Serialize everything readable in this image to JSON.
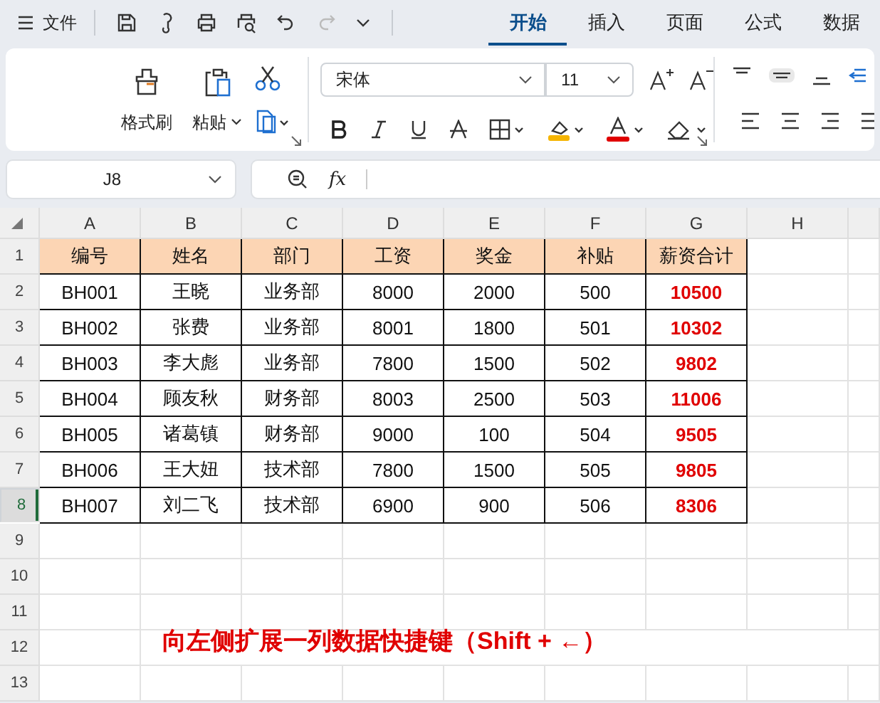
{
  "menu": {
    "label": "文件"
  },
  "tabs": [
    {
      "label": "开始",
      "selected": true
    },
    {
      "label": "插入",
      "selected": false
    },
    {
      "label": "页面",
      "selected": false
    },
    {
      "label": "公式",
      "selected": false
    },
    {
      "label": "数据",
      "selected": false
    }
  ],
  "ribbon": {
    "format_painter": "格式刷",
    "paste": "粘贴",
    "font_name": "宋体",
    "font_size": "11"
  },
  "formula_bar": {
    "name_box": "J8",
    "fx": "fx"
  },
  "columns": [
    "A",
    "B",
    "C",
    "D",
    "E",
    "F",
    "G",
    "H"
  ],
  "table": {
    "header_number": "1",
    "header": [
      "编号",
      "姓名",
      "部门",
      "工资",
      "奖金",
      "补贴",
      "薪资合计"
    ],
    "rows": [
      {
        "number": "2",
        "selected": false,
        "cells": [
          "BH001",
          "王晓",
          "业务部",
          "8000",
          "2000",
          "500"
        ],
        "total": "10500"
      },
      {
        "number": "3",
        "selected": false,
        "cells": [
          "BH002",
          "张费",
          "业务部",
          "8001",
          "1800",
          "501"
        ],
        "total": "10302"
      },
      {
        "number": "4",
        "selected": false,
        "cells": [
          "BH003",
          "李大彪",
          "业务部",
          "7800",
          "1500",
          "502"
        ],
        "total": "9802"
      },
      {
        "number": "5",
        "selected": false,
        "cells": [
          "BH004",
          "顾友秋",
          "财务部",
          "8003",
          "2500",
          "503"
        ],
        "total": "11006"
      },
      {
        "number": "6",
        "selected": false,
        "cells": [
          "BH005",
          "诸葛镇",
          "财务部",
          "9000",
          "100",
          "504"
        ],
        "total": "9505"
      },
      {
        "number": "7",
        "selected": false,
        "cells": [
          "BH006",
          "王大妞",
          "技术部",
          "7800",
          "1500",
          "505"
        ],
        "total": "9805"
      },
      {
        "number": "8",
        "selected": true,
        "cells": [
          "BH007",
          "刘二飞",
          "技术部",
          "6900",
          "900",
          "506"
        ],
        "total": "8306"
      }
    ]
  },
  "empty_rows": [
    {
      "number": "9"
    },
    {
      "number": "10"
    },
    {
      "number": "11"
    },
    {
      "number": "12",
      "text": "向左侧扩展一列数据快捷键（Shift + ←）"
    },
    {
      "number": "13"
    }
  ]
}
